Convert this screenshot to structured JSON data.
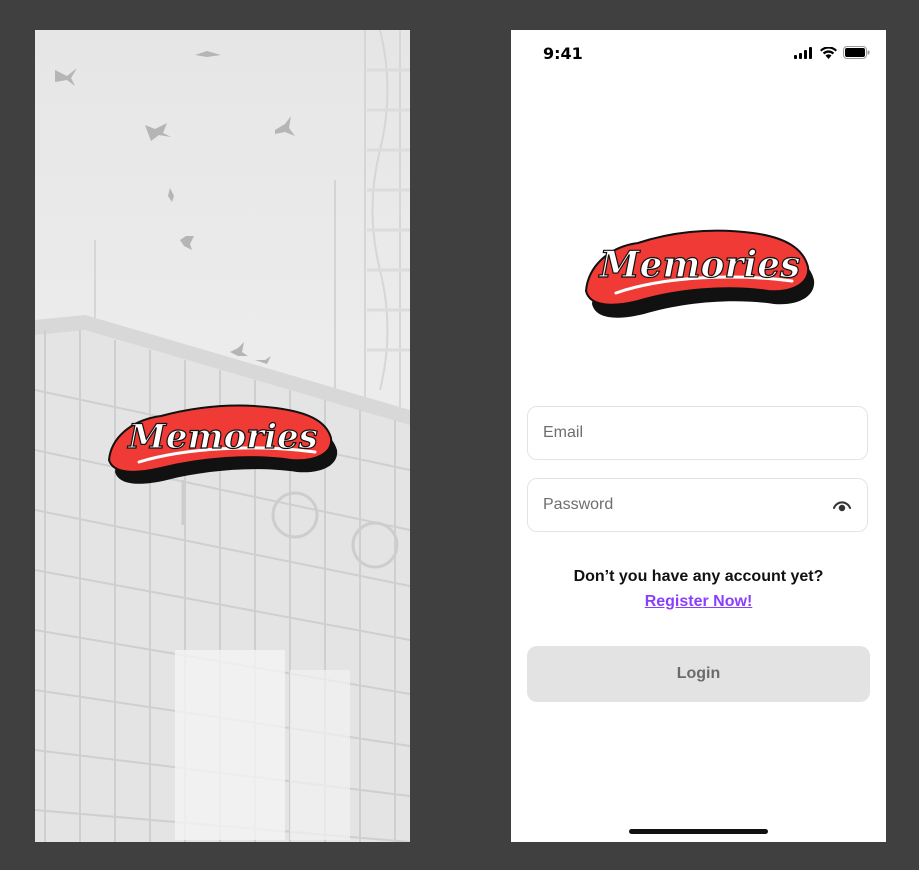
{
  "brand": {
    "logo_text": "Memories",
    "colors": {
      "logo_red": "#f03a36",
      "logo_shadow": "#111111",
      "logo_text": "#ffffff",
      "accent": "#8a3ffc",
      "button_bg": "#e3e3e3",
      "canvas": "#404040"
    }
  },
  "splash": {
    "background": "grayscale city building with birds",
    "logo_icon": "memories-logo"
  },
  "login": {
    "status_bar": {
      "time": "9:41",
      "icons": [
        "cellular-signal-icon",
        "wifi-icon",
        "battery-icon"
      ]
    },
    "email": {
      "placeholder": "Email",
      "value": ""
    },
    "password": {
      "placeholder": "Password",
      "value": "",
      "toggle_icon": "eye-icon"
    },
    "prompt_text": "Don’t you have any account yet?",
    "register_link": "Register Now!",
    "login_button": "Login"
  }
}
